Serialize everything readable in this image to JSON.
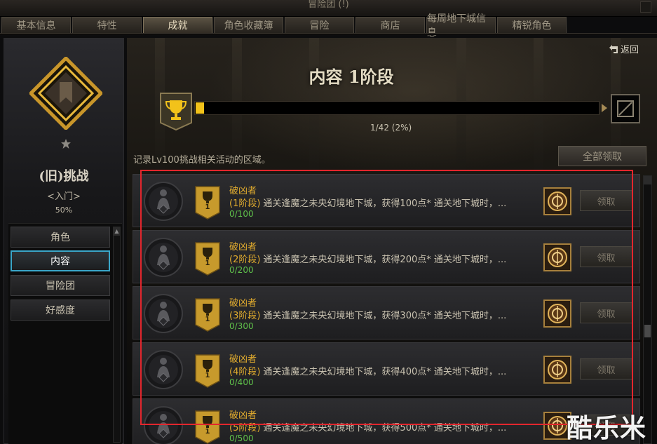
{
  "window": {
    "title": "冒险团 (!)"
  },
  "tabs": [
    {
      "label": "基本信息",
      "active": false
    },
    {
      "label": "特性",
      "active": false
    },
    {
      "label": "成就",
      "active": true
    },
    {
      "label": "角色收藏簿",
      "active": false
    },
    {
      "label": "冒险",
      "active": false
    },
    {
      "label": "商店",
      "active": false
    },
    {
      "label": "每周地下城信息",
      "active": false
    },
    {
      "label": "精锐角色",
      "active": false
    }
  ],
  "sidebar": {
    "category_title": "(旧)挑战",
    "level": "<入门>",
    "percent": "50%",
    "items": [
      {
        "label": "角色",
        "active": false
      },
      {
        "label": "内容",
        "active": true
      },
      {
        "label": "冒险团",
        "active": false
      },
      {
        "label": "好感度",
        "active": false
      }
    ]
  },
  "main": {
    "back_label": "返回",
    "stage_title": "内容 1阶段",
    "progress": {
      "text": "1/42 (2%)",
      "fraction": 0.02
    },
    "description": "记录Lv100挑战相关活动的区域。",
    "claim_all_label": "全部领取"
  },
  "achievements": [
    {
      "name": "破凶者",
      "stage": "(1阶段)",
      "text": "通关逢魔之未央幻境地下城，获得100点* 通关地下城时，...",
      "count": "0/100",
      "rank": "1",
      "claim_label": "领取"
    },
    {
      "name": "破凶者",
      "stage": "(2阶段)",
      "text": "通关逢魔之未央幻境地下城，获得200点* 通关地下城时，...",
      "count": "0/200",
      "rank": "1",
      "claim_label": "领取"
    },
    {
      "name": "破凶者",
      "stage": "(3阶段)",
      "text": "通关逢魔之未央幻境地下城，获得300点* 通关地下城时，...",
      "count": "0/300",
      "rank": "1",
      "claim_label": "领取"
    },
    {
      "name": "破凶者",
      "stage": "(4阶段)",
      "text": "通关逢魔之未央幻境地下城，获得400点* 通关地下城时，...",
      "count": "0/400",
      "rank": "1",
      "claim_label": "领取"
    },
    {
      "name": "破凶者",
      "stage": "(5阶段)",
      "text": "通关逢魔之未央幻境地下城，获得500点* 通关地下城时，...",
      "count": "0/500",
      "rank": "1",
      "claim_label": "领取"
    }
  ],
  "watermark": "酷乐米",
  "colors": {
    "accent_gold": "#e0ab2e",
    "progress_fill": "#f2c21a",
    "active_blue": "#3aa6c8",
    "highlight_red": "#e3262d",
    "count_green": "#5fc04a"
  },
  "icons": {
    "back": "return-arrow-icon",
    "trophy": "trophy-icon",
    "medal": "character-medal-icon",
    "reward": "reward-box-icon",
    "emblem": "category-emblem-icon"
  }
}
